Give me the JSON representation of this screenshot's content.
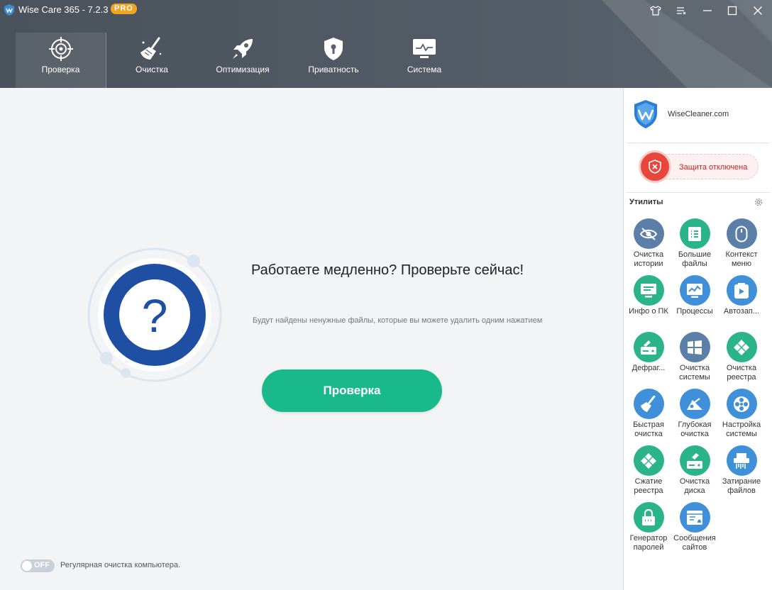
{
  "window": {
    "title": "Wise Care 365 - 7.2.3",
    "badge": "PRO"
  },
  "nav": [
    {
      "label": "Проверка",
      "icon": "target-icon",
      "active": true
    },
    {
      "label": "Очистка",
      "icon": "broom-icon",
      "active": false
    },
    {
      "label": "Оптимизация",
      "icon": "rocket-icon",
      "active": false
    },
    {
      "label": "Приватность",
      "icon": "shield-lock-icon",
      "active": false
    },
    {
      "label": "Система",
      "icon": "monitor-icon",
      "active": false
    }
  ],
  "main": {
    "title": "Работаете медленно? Проверьте сейчас!",
    "subtitle": "Будут найдены ненужные файлы, которые вы можете удалить одним нажатием",
    "scan_button": "Проверка",
    "toggle_state": "OFF",
    "toggle_label": "Регулярная очистка компьютера."
  },
  "sidebar": {
    "brand": "WiseCleaner.com",
    "protection": "Защита отключена",
    "utils_title": "Утилиты",
    "tools": [
      {
        "label": "Очистка\nистории",
        "icon": "eye-off-icon",
        "color": "#5b7fa6"
      },
      {
        "label": "Большие\nфайлы",
        "icon": "file-list-icon",
        "color": "#2bb38a"
      },
      {
        "label": "Контекст\nменю",
        "icon": "mouse-icon",
        "color": "#5b7fa6"
      },
      {
        "label": "Инфо о ПК",
        "icon": "pc-info-icon",
        "color": "#2bb38a"
      },
      {
        "label": "Процессы",
        "icon": "process-icon",
        "color": "#3f8fd9"
      },
      {
        "label": "Автозап...",
        "icon": "startup-icon",
        "color": "#3f8fd9"
      },
      {
        "label": "Дефраг...",
        "icon": "defrag-icon",
        "color": "#2bb38a"
      },
      {
        "label": "Очистка\nсистемы",
        "icon": "windows-icon",
        "color": "#5b7fa6"
      },
      {
        "label": "Очистка\nреестра",
        "icon": "registry-icon",
        "color": "#2bb38a"
      },
      {
        "label": "Быстрая\nочистка",
        "icon": "brush-icon",
        "color": "#3f8fd9"
      },
      {
        "label": "Глубокая\nочистка",
        "icon": "deep-clean-icon",
        "color": "#3f8fd9"
      },
      {
        "label": "Настройка\nсистемы",
        "icon": "fan-icon",
        "color": "#3f8fd9"
      },
      {
        "label": "Сжатие\nреестра",
        "icon": "registry-compress-icon",
        "color": "#2bb38a"
      },
      {
        "label": "Очистка\nдиска",
        "icon": "disk-clean-icon",
        "color": "#2bb38a"
      },
      {
        "label": "Затирание\nфайлов",
        "icon": "shredder-icon",
        "color": "#3f8fd9"
      },
      {
        "label": "Генератор\nпаролей",
        "icon": "password-lock-icon",
        "color": "#2bb38a"
      },
      {
        "label": "Сообщения\nсайтов",
        "icon": "web-notify-icon",
        "color": "#3f8fd9"
      }
    ]
  }
}
